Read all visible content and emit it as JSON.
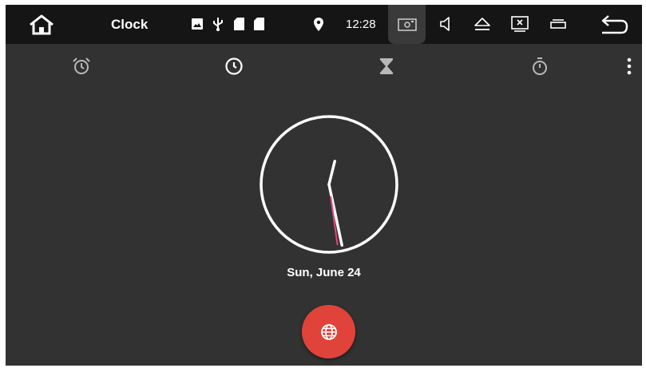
{
  "status_bar": {
    "app_title": "Clock",
    "time": "12:28",
    "icons": [
      "home-icon",
      "image-icon",
      "usb-icon",
      "sd-card-icon",
      "sd-card-icon",
      "location-icon",
      "screenshot-icon",
      "volume-icon",
      "eject-icon",
      "close-window-icon",
      "recent-apps-icon",
      "back-icon"
    ]
  },
  "tabs": [
    {
      "name": "alarm",
      "icon": "alarm-icon"
    },
    {
      "name": "clock",
      "icon": "clock-icon",
      "selected": true
    },
    {
      "name": "timer",
      "icon": "hourglass-icon"
    },
    {
      "name": "stopwatch",
      "icon": "stopwatch-icon"
    }
  ],
  "clock": {
    "hour_angle_deg": 14,
    "minute_angle_deg": 168,
    "second_angle_deg": 172,
    "second_hand_color": "#e8437a"
  },
  "date_label": "Sun, June 24",
  "fab": {
    "icon": "globe-icon",
    "color": "#e0433a"
  },
  "colors": {
    "statusbar_bg": "#151515",
    "screen_bg": "#323232",
    "accent": "#e0433a"
  }
}
